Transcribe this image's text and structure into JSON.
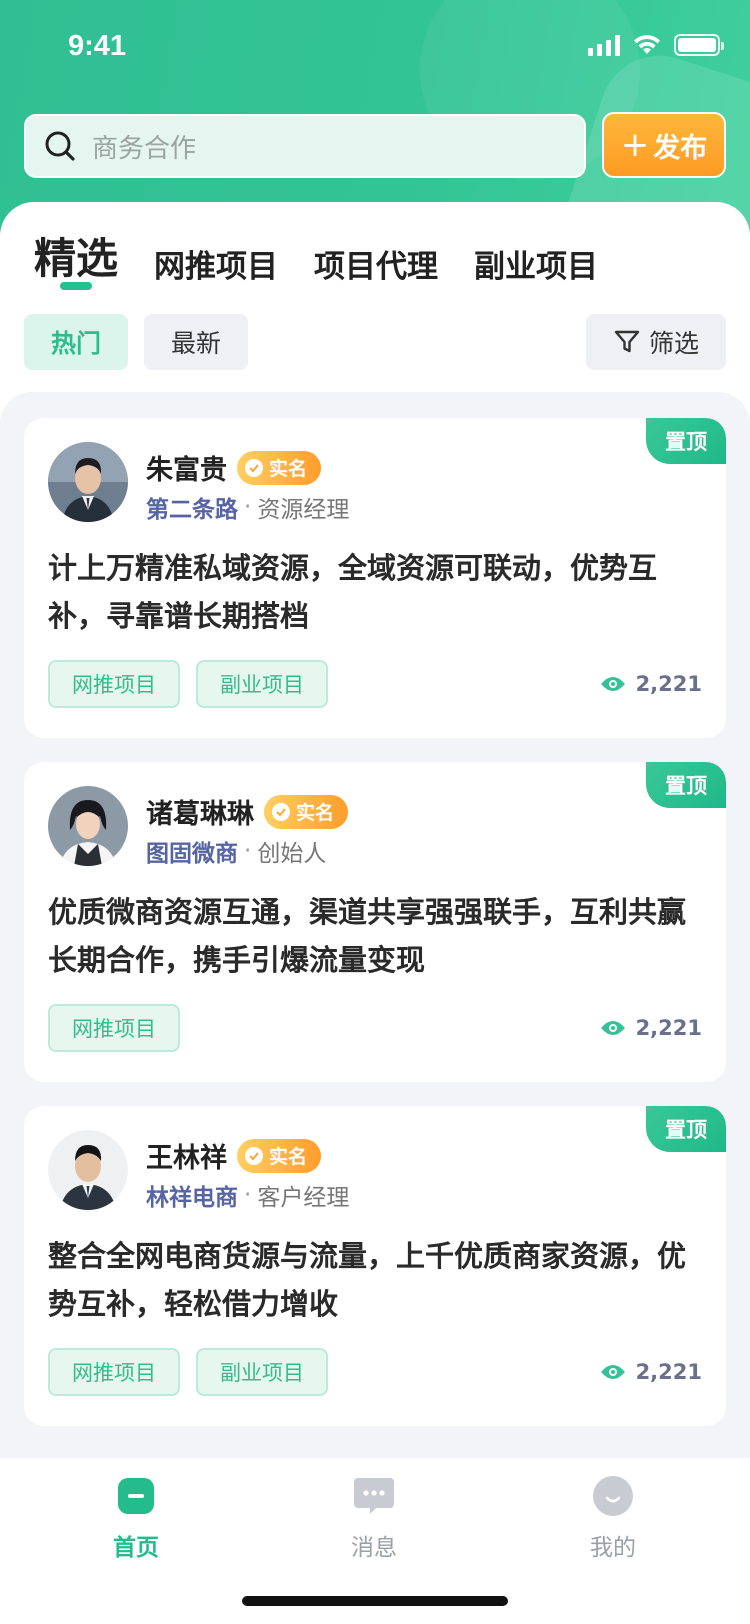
{
  "status": {
    "time": "9:41"
  },
  "search": {
    "placeholder": "商务合作",
    "icon": "search-icon"
  },
  "publish": {
    "plus": "+",
    "label": "发布"
  },
  "tabs": [
    {
      "label": "精选"
    },
    {
      "label": "网推项目"
    },
    {
      "label": "项目代理"
    },
    {
      "label": "副业项目"
    }
  ],
  "chips": {
    "hot": "热门",
    "latest": "最新",
    "filter": "筛选"
  },
  "pin_label": "置顶",
  "verified_label": "实名",
  "cards": [
    {
      "name": "朱富贵",
      "company": "第二条路",
      "role": "资源经理",
      "desc": "计上万精准私域资源，全域资源可联动，优势互补，寻靠谱长期搭档",
      "tags": [
        "网推项目",
        "副业项目"
      ],
      "views": "2,221"
    },
    {
      "name": "诸葛琳琳",
      "company": "图固微商",
      "role": "创始人",
      "desc": "优质微商资源互通，渠道共享强强联手，互利共赢长期合作，携手引爆流量变现",
      "tags": [
        "网推项目"
      ],
      "views": "2,221"
    },
    {
      "name": "王林祥",
      "company": "林祥电商",
      "role": "客户经理",
      "desc": "整合全网电商货源与流量，上千优质商家资源，优势互补，轻松借力增收",
      "tags": [
        "网推项目",
        "副业项目"
      ],
      "views": "2,221"
    }
  ],
  "tabbar": {
    "home": "首页",
    "messages": "消息",
    "me": "我的"
  },
  "colors": {
    "accent": "#24c08f",
    "badge": "#ff9d2c",
    "company": "#5664a4"
  }
}
